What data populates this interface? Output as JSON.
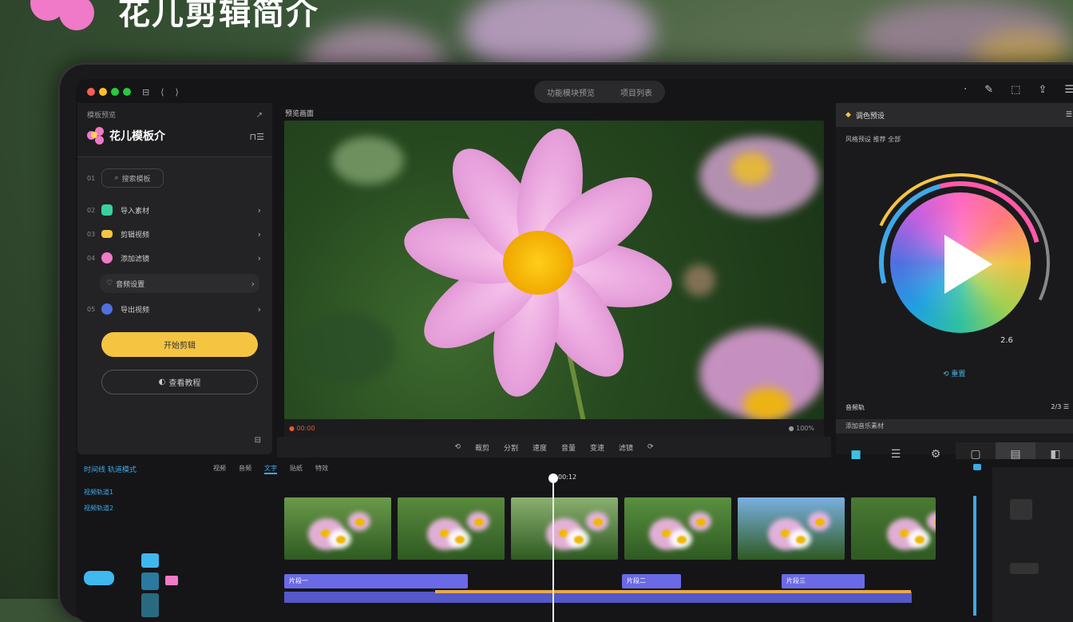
{
  "banner": {
    "title": "花儿剪辑简介"
  },
  "topbar": {
    "icons": [
      "sidebar-icon",
      "back-icon",
      "forward-icon"
    ],
    "pill_left": "功能模块预览",
    "pill_right": "项目列表",
    "right_icons": [
      "help-icon",
      "edit-icon",
      "share-icon",
      "export-icon",
      "menu-icon"
    ]
  },
  "sidebar": {
    "header_small": "模板预览",
    "brand": "花儿模板介",
    "corner_icon": "↗",
    "toggle_icon": "⊓☰",
    "search_num": "01",
    "search_label": "搜索模板",
    "items": [
      {
        "num": "02",
        "label": "导入素材",
        "color": "#39d0a0"
      },
      {
        "num": "03",
        "label": "剪辑视频",
        "color": "#f5c542"
      },
      {
        "num": "04",
        "label": "添加滤镜",
        "color": "#f07ac8"
      },
      {
        "num": "",
        "label": "音频设置",
        "color": ""
      },
      {
        "num": "05",
        "label": "导出视频",
        "color": "#5070e0"
      }
    ],
    "primary_button": "开始剪辑",
    "secondary_button": "查看教程",
    "footer_icon": "⊟"
  },
  "preview": {
    "label": "预览画面",
    "bar_left": "● 00:00",
    "bar_right": "● 100%",
    "tools": [
      "⟲",
      "裁剪",
      "分割",
      "速度",
      "音量",
      "变速",
      "滤镜",
      "⟳"
    ]
  },
  "right_panel": {
    "title": "调色预设",
    "menu_icon": "☰",
    "subtitle": "风格预设  推荐  全部",
    "value": "2.6",
    "link": "⟲ 重置",
    "row_label": "音频轨",
    "row_right": "2/3 ☰",
    "row2": "添加音乐素材",
    "tabs": [
      "folder-icon",
      "list-icon",
      "gear-icon",
      "square-icon",
      "image-icon",
      "flag-icon"
    ]
  },
  "timeline": {
    "header": "时间线  轨道模式",
    "tabs": [
      "视频",
      "音频",
      "文字",
      "贴纸",
      "特效"
    ],
    "left_labels": [
      "视频轨道1",
      "视频轨道2"
    ],
    "playhead_time": "00:12",
    "tracks": [
      {
        "label": "片段一"
      },
      {
        "label": "片段二"
      },
      {
        "label": "片段三"
      }
    ]
  }
}
